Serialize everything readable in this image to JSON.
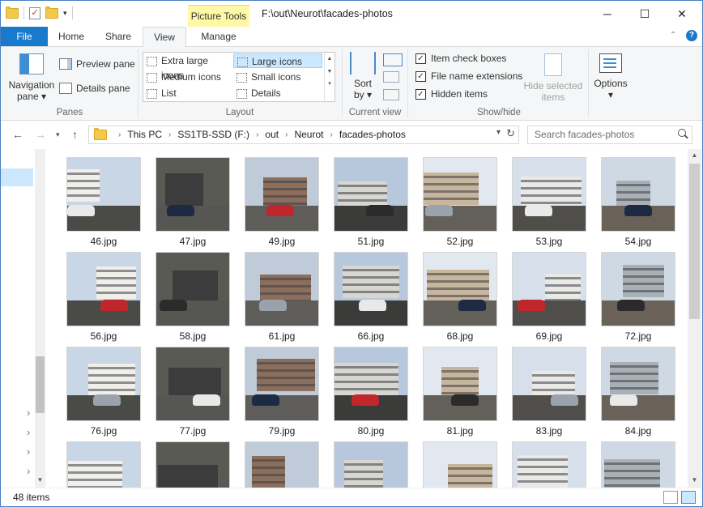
{
  "window": {
    "title": "F:\\out\\Neurot\\facades-photos",
    "contextual_tab_group": "Picture Tools",
    "controls": {
      "minimize": "─",
      "maximize": "☐",
      "close": "✕"
    }
  },
  "ribbon": {
    "tabs": [
      "File",
      "Home",
      "Share",
      "View",
      "Manage"
    ],
    "active_tab": "View",
    "panes": {
      "label": "Panes",
      "navigation_pane": "Navigation pane",
      "preview_pane": "Preview pane",
      "details_pane": "Details pane"
    },
    "layout": {
      "label": "Layout",
      "options": [
        "Extra large icons",
        "Large icons",
        "Medium icons",
        "Small icons",
        "List",
        "Details"
      ],
      "selected": "Large icons"
    },
    "current_view": {
      "label": "Current view",
      "sort_by": "Sort by"
    },
    "show_hide": {
      "label": "Show/hide",
      "item_check_boxes": "Item check boxes",
      "file_name_extensions": "File name extensions",
      "hidden_items": "Hidden items",
      "hide_selected_items": "Hide selected items"
    },
    "options": {
      "label": "Options"
    }
  },
  "address_bar": {
    "breadcrumbs": [
      "This PC",
      "SS1TB-SSD (F:)",
      "out",
      "Neurot",
      "facades-photos"
    ],
    "search_placeholder": "Search facades-photos"
  },
  "files": [
    {
      "name": "46.jpg"
    },
    {
      "name": "47.jpg"
    },
    {
      "name": "49.jpg"
    },
    {
      "name": "51.jpg"
    },
    {
      "name": "52.jpg"
    },
    {
      "name": "53.jpg"
    },
    {
      "name": "54.jpg"
    },
    {
      "name": "56.jpg"
    },
    {
      "name": "58.jpg"
    },
    {
      "name": "61.jpg"
    },
    {
      "name": "66.jpg"
    },
    {
      "name": "68.jpg"
    },
    {
      "name": "69.jpg"
    },
    {
      "name": "72.jpg"
    },
    {
      "name": "76.jpg"
    },
    {
      "name": "77.jpg"
    },
    {
      "name": "79.jpg"
    },
    {
      "name": "80.jpg"
    },
    {
      "name": "81.jpg"
    },
    {
      "name": "83.jpg"
    },
    {
      "name": "84.jpg"
    },
    {
      "name": ""
    },
    {
      "name": ""
    },
    {
      "name": ""
    },
    {
      "name": ""
    },
    {
      "name": ""
    },
    {
      "name": ""
    },
    {
      "name": ""
    }
  ],
  "status": {
    "item_count": "48 items"
  },
  "colors": {
    "accent": "#1979ca",
    "selection": "#cce8ff",
    "picture_tools": "#fff8a6"
  }
}
